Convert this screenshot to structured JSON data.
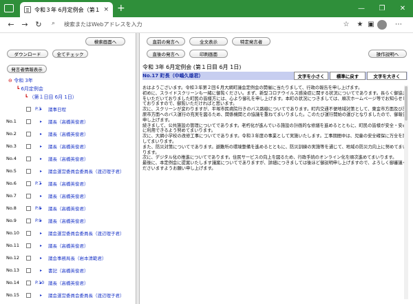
{
  "browser": {
    "tab_title": "令和３年 6月定例会（第１日目 6",
    "tab_close": "×",
    "new_tab": "+",
    "address_placeholder": "検索またはWebアドレスを入力",
    "window_controls": [
      "—",
      "❐",
      "✕"
    ]
  },
  "left_panel": {
    "search_screen_button": "検索画面へ",
    "download_button": "ダウンロード",
    "check_all_button": "全てチェック",
    "speaker_list_button": "発言者情報表示",
    "tree": {
      "year": "令和 3年",
      "session": "6月定例会",
      "day": "（第１日目 6月 1日）"
    },
    "rows": [
      {
        "no": "",
        "page": "P.3",
        "label": "議事日程"
      },
      {
        "no": "No.1",
        "page": "",
        "label": "議長（高橋英俊君）"
      },
      {
        "no": "No.2",
        "page": "",
        "label": "議長（高橋英俊君）"
      },
      {
        "no": "No.3",
        "page": "",
        "label": "議長（高橋英俊君）"
      },
      {
        "no": "No.4",
        "page": "",
        "label": "議長（高橋英俊君）"
      },
      {
        "no": "No.5",
        "page": "",
        "label": "議会運営委員会委員長（渡辺理子君）"
      },
      {
        "no": "No.6",
        "page": "P.7",
        "label": "議長（高橋英俊君）"
      },
      {
        "no": "No.7",
        "page": "",
        "label": "議長（高橋英俊君）"
      },
      {
        "no": "No.8",
        "page": "P.8",
        "label": "議長（高橋英俊君）"
      },
      {
        "no": "No.9",
        "page": "P.9",
        "label": "議長（高橋英俊君）"
      },
      {
        "no": "No.10",
        "page": "",
        "label": "議会運営委員会委員長（渡辺理子君）"
      },
      {
        "no": "No.11",
        "page": "",
        "label": "議長（高橋英俊君）"
      },
      {
        "no": "No.12",
        "page": "",
        "label": "議会事務局長（岩本清範君）"
      },
      {
        "no": "No.13",
        "page": "",
        "label": "書記（高橋英俊君）"
      },
      {
        "no": "No.14",
        "page": "P.10",
        "label": "議長（高橋英俊君）"
      },
      {
        "no": "No.15",
        "page": "",
        "label": "議会運営委員会委員長（渡辺理子君）"
      }
    ]
  },
  "right_panel": {
    "buttons": {
      "prev_speech": "直前の発言へ",
      "full_text": "全文表示",
      "specific_speaker": "特定発言者",
      "next_speech": "直後の発言へ",
      "print_screen": "印刷画面",
      "operation_help": "操作説明へ"
    },
    "meeting_title": "令和 3年 6月定例会 (第１日目 6月 1日)",
    "speaker": "No.17 町長（中嶋久雄君）",
    "font_small": "文字を小さく",
    "font_standard": "標準に戻す",
    "font_large": "文字を大きく",
    "body": [
      "おはようございます。令和３年第２回６月大網町議会定例会の開催に当たりまして、行政の報告を申し上げます。",
      "初めに、スライドスクリーンも一緒に御覧ください。まず、新型コロナウイルス感染症に関する状況についてであります。長らく御協力をいただいておりました町民の皆様方には、心より御礼を申し上げます。本町の状況につきましては、順次ホームページ等でお知らせしておりますので、御覧いただければと思います。",
      "次に、スクリーンが変わりますが、平塚市民病院行きのバス路線についてであります。町内交通不便地域対策として、東金市方面及び茂原市方面へのバス運行の充実を図るため、関係機関との協議を重ねてまいりました。このたび運行開始の運びとなりましたので、御報告申し上げます。",
      "続きまして、公共施設の管理についてであります。老朽化が進んでいる施設の計画的な修繕を進めるとともに、町民の皆様が安全・安心に利用できるよう努めてまいります。",
      "次に、大網小学校の改修工事についてであります。令和３年度の事業として実施いたします。工事期間中は、児童の安全確保に万全を期してまいります。",
      "また、防災対策についてであります。避難所の環境整備を進めるとともに、防災訓練の実施等を通じて、地域の防災力向上に努めてまいります。",
      "次に、デジタル化の推進についてであります。住民サービスの向上を図るため、行政手続のオンライン化を順次進めてまいります。",
      "最後に、本定例会に提案いたします議案についてでありますが、詳細につきましては後ほど御説明申し上げますので、よろしく御審議くださいますようお願い申し上げます。"
    ]
  }
}
